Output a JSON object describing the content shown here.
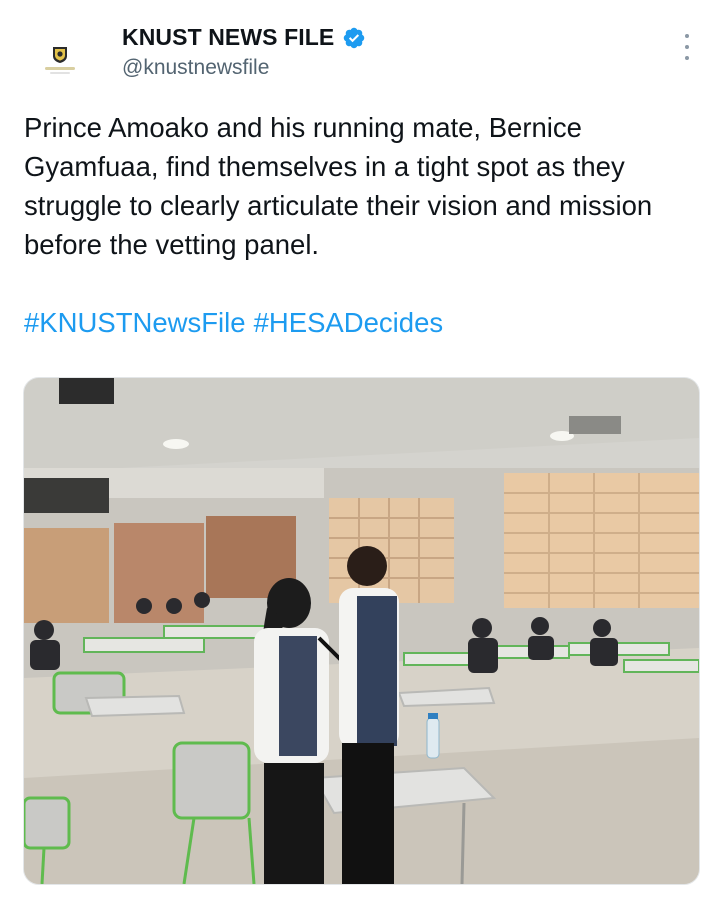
{
  "tweet": {
    "author_name": "KNUST NEWS FILE",
    "author_handle": "@knustnewsfile",
    "verified": true,
    "text": "Prince Amoako and his running mate, Bernice Gyamfuaa, find themselves in a tight spot as they struggle to clearly articulate their vision and mission before the vetting panel.",
    "hashtags": [
      "#KNUSTNewsFile",
      "#HESADecides"
    ]
  },
  "icons": {
    "avatar": "knust-news-file-logo",
    "verified": "verified-badge-icon",
    "more": "more-options-icon"
  },
  "colors": {
    "accent": "#1d9bf0",
    "text": "#0f1419",
    "secondary_text": "#536471"
  }
}
